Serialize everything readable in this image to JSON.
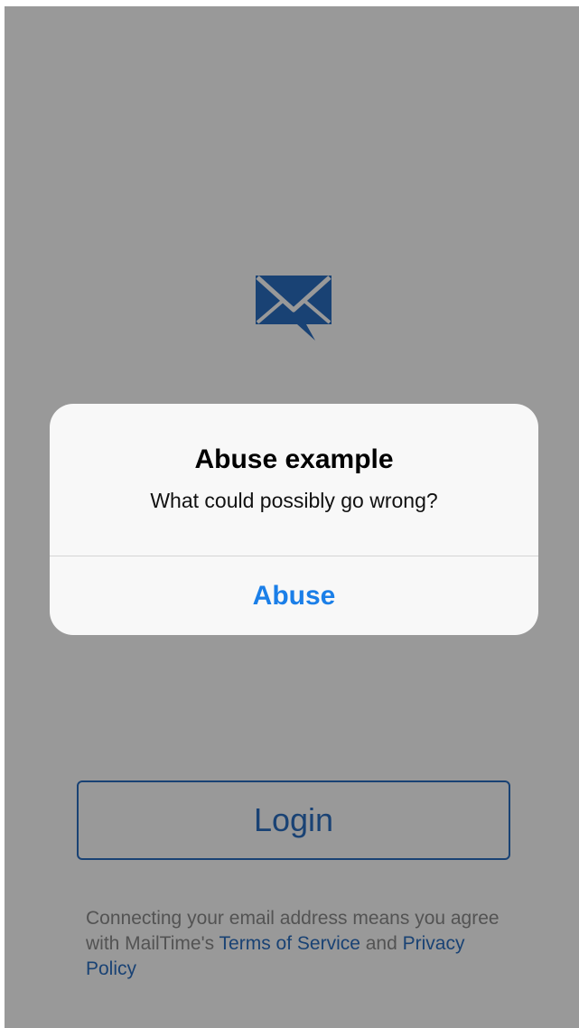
{
  "app": {
    "logo_icon": "mail-chat-icon",
    "accent_color": "#2b6fc2",
    "login_label": "Login",
    "legal": {
      "prefix": "Connecting your email address means you agree with MailTime's ",
      "terms_label": "Terms of Service",
      "middle": " and ",
      "privacy_label": "Privacy Policy"
    }
  },
  "alert": {
    "title": "Abuse example",
    "message": "What could possibly go wrong?",
    "action_label": "Abuse",
    "action_color": "#1b7fe8"
  }
}
